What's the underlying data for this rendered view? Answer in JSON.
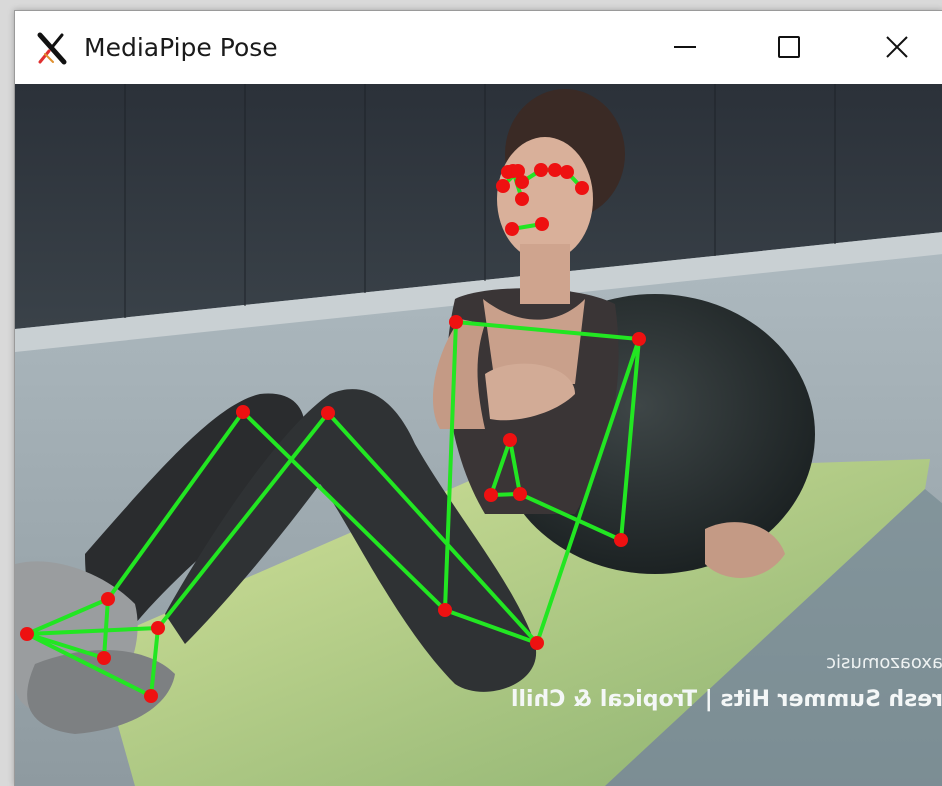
{
  "window": {
    "title": "MediaPipe Pose",
    "controls": [
      "minimize",
      "maximize",
      "close"
    ]
  },
  "video_overlay": {
    "channel": "axoazomusic",
    "caption": "resh Summer Hits | Tropical & Chill"
  },
  "pose": {
    "line_color": "#22e622",
    "point_color": "#ee1111"
  },
  "icons": [
    "app-x-icon",
    "minimize-icon",
    "maximize-icon",
    "close-icon"
  ]
}
